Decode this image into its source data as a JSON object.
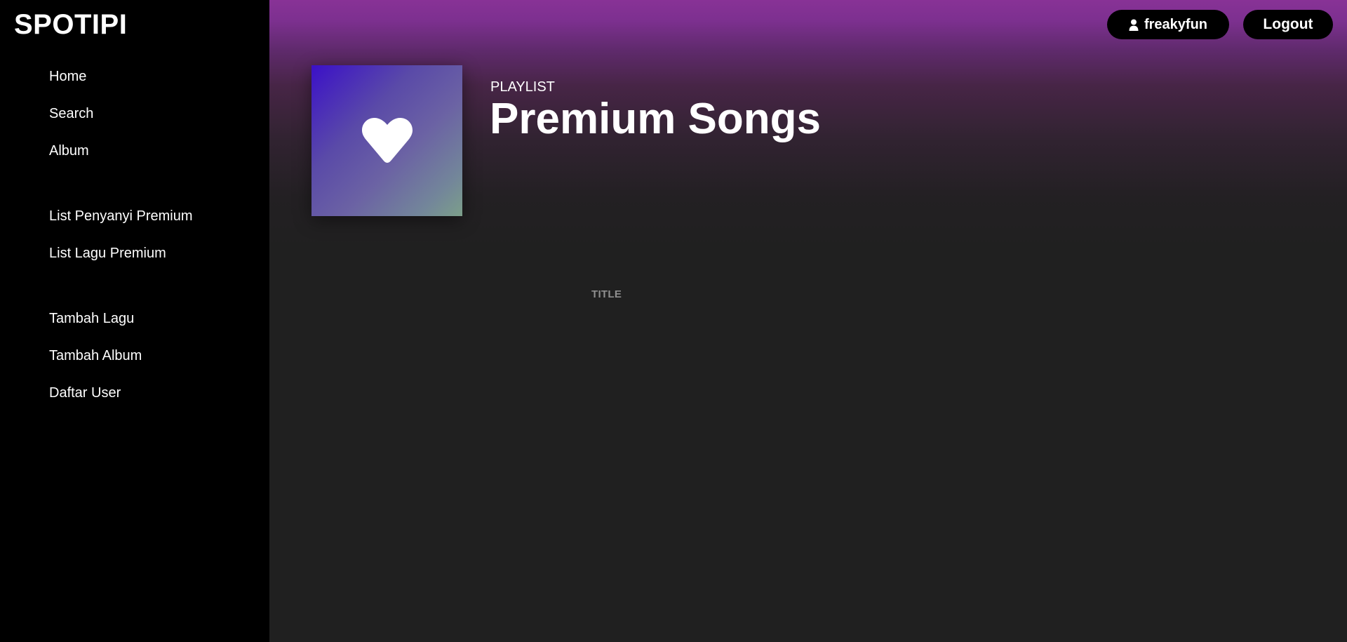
{
  "app": {
    "logo": "SPOTIPI"
  },
  "sidebar": {
    "groups": [
      {
        "items": [
          {
            "label": "Home"
          },
          {
            "label": "Search"
          },
          {
            "label": "Album"
          }
        ]
      },
      {
        "items": [
          {
            "label": "List Penyanyi Premium"
          },
          {
            "label": "List Lagu Premium"
          }
        ]
      },
      {
        "items": [
          {
            "label": "Tambah Lagu"
          },
          {
            "label": "Tambah Album"
          },
          {
            "label": "Daftar User"
          }
        ]
      }
    ]
  },
  "header": {
    "user_button": {
      "label": "freakyfun",
      "icon": "user-icon"
    },
    "logout_button": {
      "label": "Logout"
    }
  },
  "playlist": {
    "type_label": "PLAYLIST",
    "title": "Premium Songs",
    "cover_icon": "heart-icon"
  },
  "table": {
    "columns": [
      {
        "label": "TITLE"
      }
    ],
    "rows": []
  },
  "colors": {
    "hero_top": "#883296",
    "background": "#202020",
    "sidebar": "#000000",
    "cover_gradient_start": "#3b10c8",
    "cover_gradient_end": "#7c9f8a",
    "header_text_muted": "#8f8f8f"
  }
}
